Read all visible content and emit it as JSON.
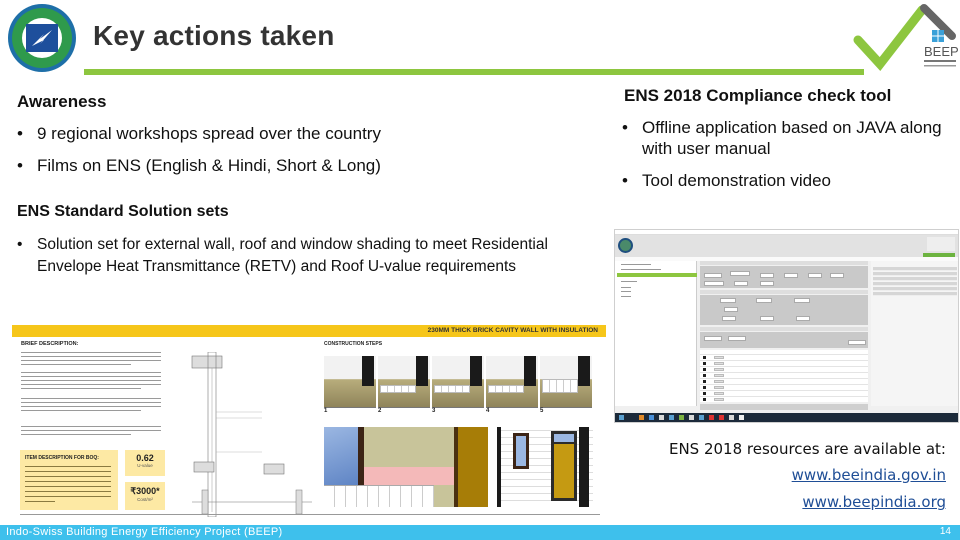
{
  "header": {
    "title": "Key actions taken",
    "left_logo": "bee-emblem-logo",
    "right_logo": "beep-logo",
    "right_logo_text": "BEEP",
    "right_logo_subtext": "BUILDING ENERGY EFFICIENCY PROJECT"
  },
  "awareness": {
    "heading": "Awareness",
    "bullets": [
      "9 regional workshops spread over the country",
      "Films on ENS (English & Hindi, Short & Long)"
    ]
  },
  "compliance_tool": {
    "heading": "ENS 2018 Compliance check tool",
    "bullets": [
      "Offline application based on JAVA along with user manual",
      "Tool demonstration video"
    ]
  },
  "solution_sets": {
    "heading": "ENS Standard Solution sets",
    "bullets": [
      "Solution set for external wall, roof and window shading to meet Residential Envelope Heat Transmittance (RETV) and Roof U-value requirements"
    ]
  },
  "poster": {
    "band_title": "230MM THICK BRICK CAVITY WALL WITH INSULATION",
    "brief_heading": "BRIEF DESCRIPTION:",
    "steps_heading": "CONSTRUCTION STEPS",
    "step_numbers": [
      "1",
      "2",
      "3",
      "4",
      "5"
    ],
    "boq_heading": "ITEM DESCRIPTION FOR BOQ:",
    "u_value": "0.62",
    "u_value_unit": "W/m²K",
    "u_value_label": "U-value",
    "cost": "₹3000*",
    "cost_unit": "Cost/m²"
  },
  "resources": {
    "text": "ENS 2018 resources are available at:",
    "links": [
      "www.beeindia.gov.in",
      "www.beepindia.org"
    ]
  },
  "footer": {
    "text": "Indo-Swiss Building Energy Efficiency Project (BEEP)",
    "page_number": "14"
  },
  "colors": {
    "accent_green": "#8dc63f",
    "footer_blue": "#3ec0ec",
    "poster_yellow": "#f6c61a",
    "link_blue": "#1f4e96"
  }
}
